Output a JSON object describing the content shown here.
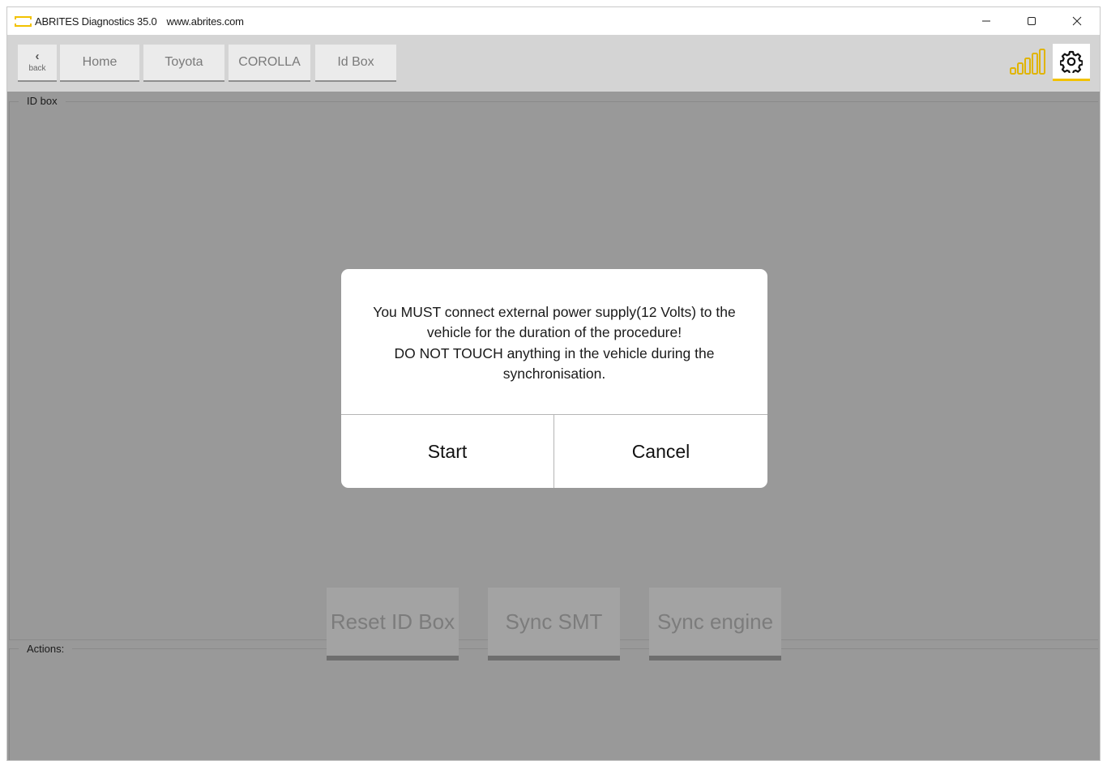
{
  "window": {
    "title": "ABRITES Diagnostics 35.0",
    "url": "www.abrites.com"
  },
  "navbar": {
    "back_label": "back",
    "breadcrumbs": [
      "Home",
      "Toyota",
      "COROLLA",
      "Id Box"
    ]
  },
  "sections": {
    "id_box_label": "ID box",
    "actions_label": "Actions:"
  },
  "actions": [
    "Reset ID Box",
    "Sync SMT",
    "Sync engine"
  ],
  "dialog": {
    "lines": [
      "You MUST connect external power supply(12 Volts) to the",
      "vehicle for the duration of the procedure!",
      "DO NOT TOUCH anything in the vehicle during the",
      "synchronisation."
    ],
    "start_label": "Start",
    "cancel_label": "Cancel"
  },
  "colors": {
    "accent": "#f2c200",
    "overlay_bg": "#999999"
  },
  "icons": {
    "back": "chevron-left-icon",
    "signal": "signal-strength-icon",
    "settings": "gear-icon"
  }
}
